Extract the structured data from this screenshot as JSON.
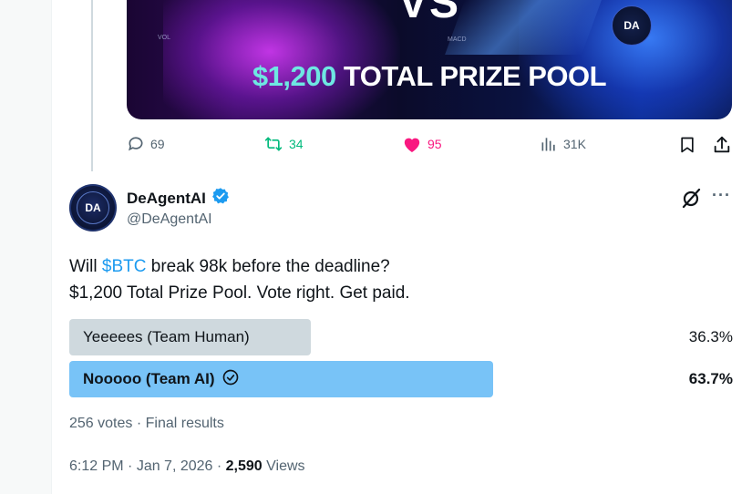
{
  "media": {
    "vs_text": "VS",
    "prize_amount": "$1,200",
    "prize_label": "TOTAL PRIZE POOL",
    "badge": "DA",
    "axis_left": "VOL",
    "axis_mid": "MACD",
    "accent_color": "#6ee7e2"
  },
  "actions": {
    "replies": "69",
    "reposts": "34",
    "likes": "95",
    "views": "31K",
    "liked": true,
    "repost_color": "#00ba7c",
    "like_color": "#f91880"
  },
  "author": {
    "name": "DeAgentAI",
    "handle": "@DeAgentAI",
    "verified": true,
    "avatar_text": "DA",
    "verified_color": "#1d9bf0"
  },
  "tweet": {
    "line1_before": "Will ",
    "cashtag": "$BTC",
    "line1_after": " break 98k before the deadline?",
    "line2": "$1,200 Total Prize Pool. Vote right. Get paid."
  },
  "poll": {
    "options": [
      {
        "label": "Yeeeees (Team Human)",
        "percent": "36.3%",
        "fraction": 0.363,
        "selected": false
      },
      {
        "label": "Nooooo (Team AI)",
        "percent": "63.7%",
        "fraction": 0.637,
        "selected": true
      }
    ],
    "votes": "256 votes",
    "separator": " · ",
    "status": "Final results",
    "winner_color": "#78c3f7",
    "other_color": "#cfd9de"
  },
  "meta": {
    "time": "6:12 PM",
    "date": "Jan 7, 2026",
    "views_count": "2,590",
    "views_label": "Views"
  },
  "icons": {
    "reply": "speech-bubble-icon",
    "repost": "repost-arrows-icon",
    "like": "heart-icon",
    "views": "bar-chart-icon",
    "bookmark": "bookmark-icon",
    "share": "share-icon",
    "grok": "grok-icon",
    "more": "more-dots-icon",
    "check": "check-circle-icon"
  }
}
